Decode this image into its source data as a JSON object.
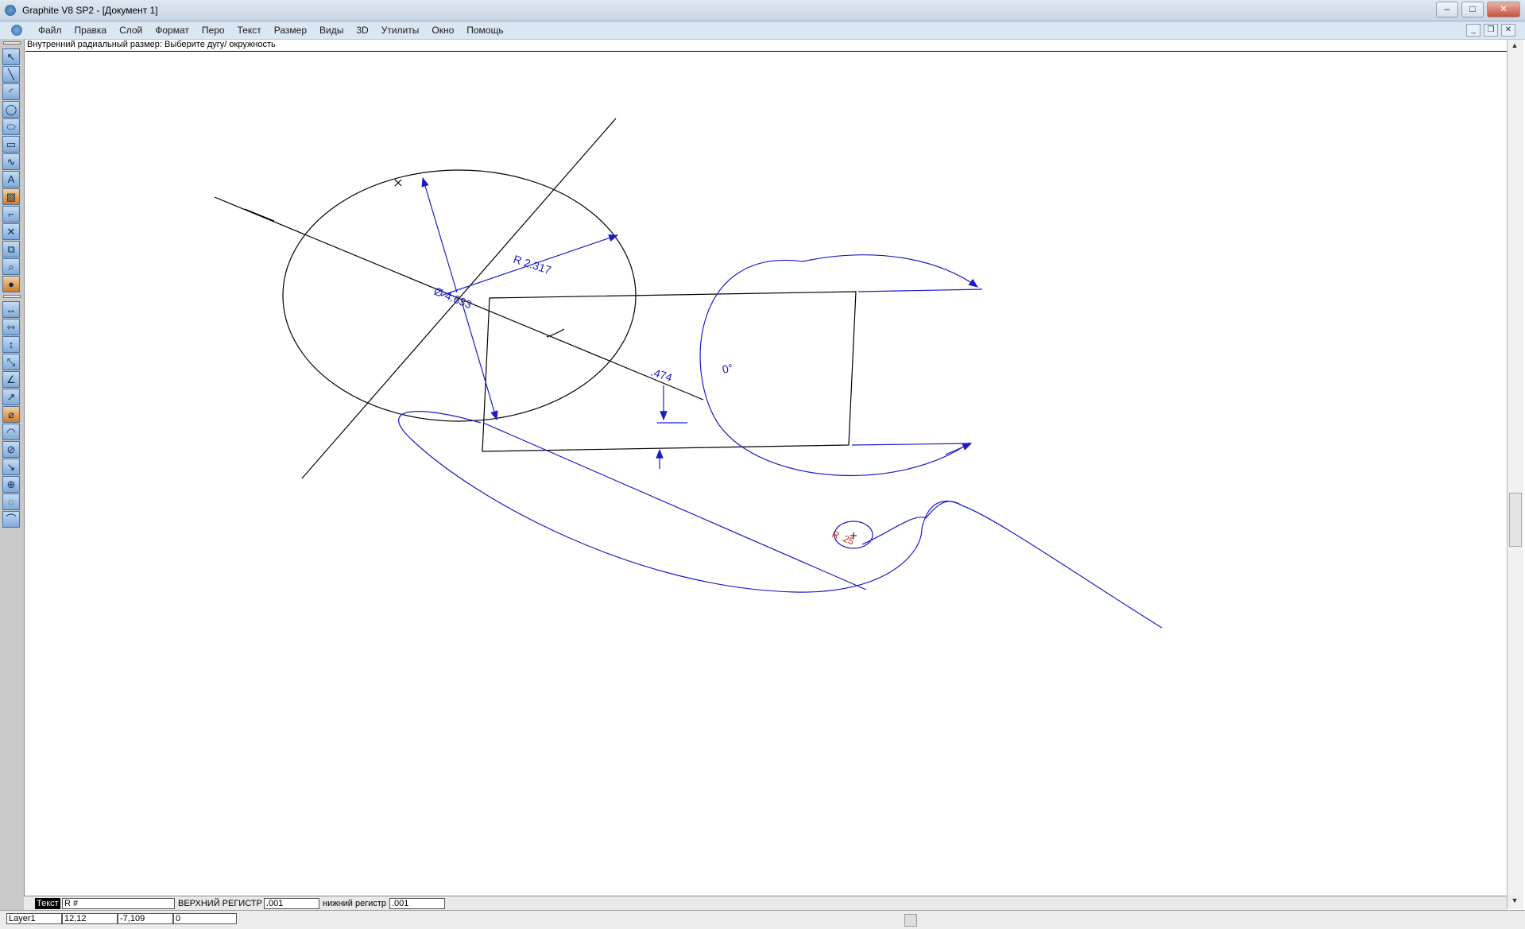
{
  "window": {
    "title": "Graphite V8 SP2 - [Документ 1]",
    "controls": {
      "minimize": "–",
      "maximize": "□",
      "close": "✕"
    },
    "mdi_controls": {
      "minimize": "_",
      "restore": "❐",
      "close": "✕"
    }
  },
  "menu": {
    "items": [
      "Файл",
      "Правка",
      "Слой",
      "Формат",
      "Перо",
      "Текст",
      "Размер",
      "Виды",
      "3D",
      "Утилиты",
      "Окно",
      "Помощь"
    ]
  },
  "prompt": "Внутренний радиальный размер: Выберите дугу/ окружность",
  "drawing": {
    "dim_radius_label": "R 2.317",
    "dim_diameter_label": "Ø 4.633",
    "dim_linear_label": ".474",
    "dim_angle_label": "0°",
    "dim_small_radius_label": "R .25",
    "colors": {
      "geometry": "#000000",
      "dimension": "#1a1acc",
      "accent": "#cc2222"
    }
  },
  "status": {
    "text_tab_label": "Текст",
    "text_value": "R #",
    "upper_label": "ВЕРХНИЙ РЕГИСТР",
    "upper_value": ".001",
    "lower_label": "нижний регистр",
    "lower_value": ".001",
    "layer": "Layer1",
    "x_coord": "12,12",
    "y_coord": "-7,109",
    "angle": "0"
  },
  "icons": {
    "left_tools": [
      "pointer-icon",
      "line-icon",
      "arc-icon",
      "circle-icon",
      "ellipse-icon",
      "rectangle-icon",
      "spline-icon",
      "text-icon",
      "hatch-icon",
      "fillet-icon",
      "trim-icon",
      "move-icon",
      "zoom-icon",
      "render-icon",
      "dim-linear-icon",
      "dim-horizontal-icon",
      "dim-vertical-icon",
      "dim-aligned-icon",
      "dim-angular-icon",
      "dim-radius-icon",
      "dim-diameter-icon",
      "dim-arc-icon",
      "dim-ordinate-icon",
      "dim-leader-icon",
      "dim-center-icon",
      "dim-balloon-icon"
    ]
  }
}
